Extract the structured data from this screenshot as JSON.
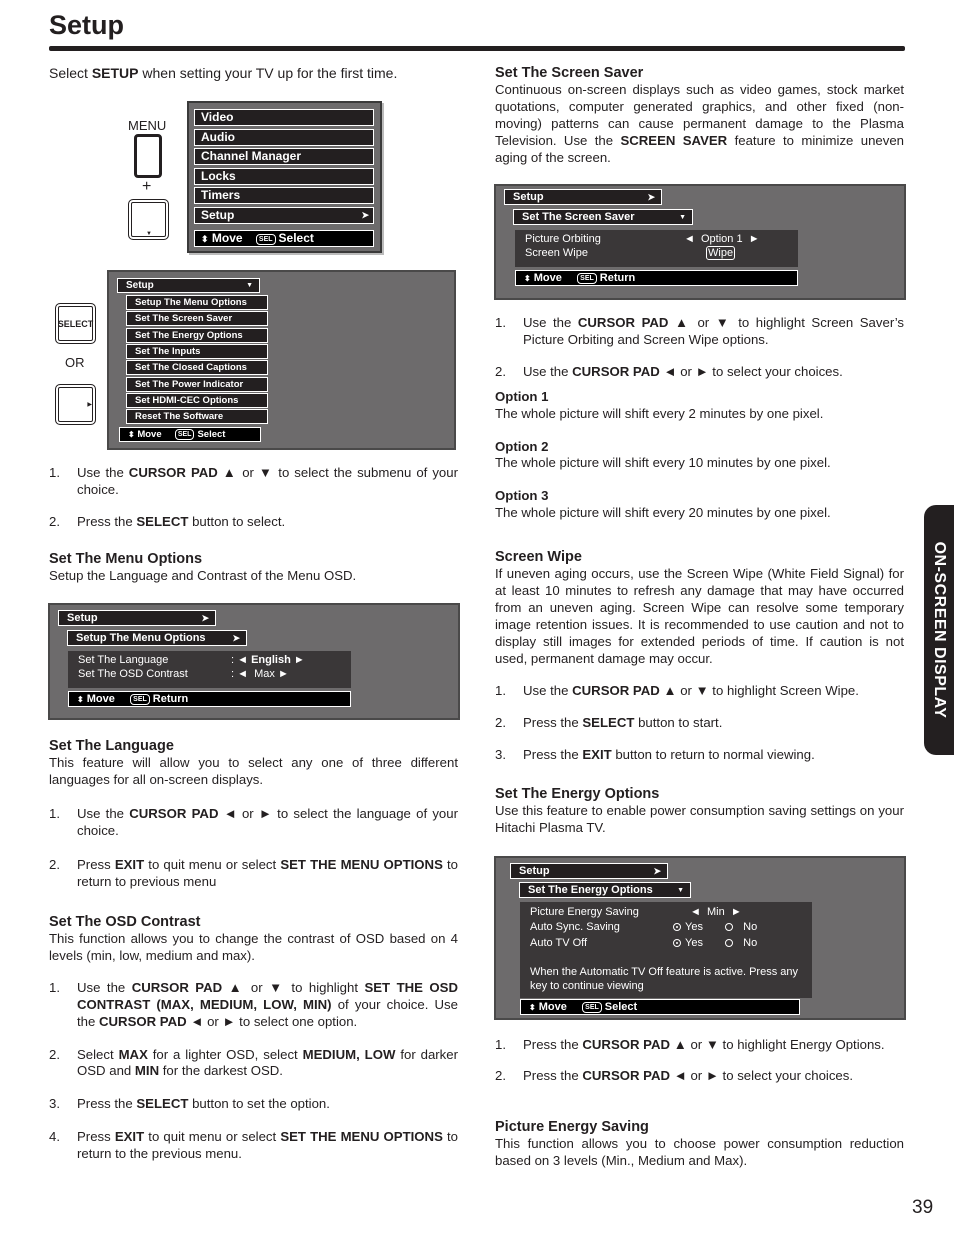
{
  "page": {
    "title": "Setup",
    "page_number": "39",
    "side_tab": "ON-SCREEN DISPLAY"
  },
  "intro": {
    "pre": "Select ",
    "bold": "SETUP",
    "post": " when setting your TV up for the first time."
  },
  "remote": {
    "menu_label": "MENU",
    "plus": "+",
    "select_label": "SELECT",
    "or": "OR"
  },
  "main_menu": {
    "items": [
      "Video",
      "Audio",
      "Channel Manager",
      "Locks",
      "Timers",
      "Setup"
    ],
    "footer_move": "Move",
    "footer_sel": "SEL",
    "footer_action": "Select"
  },
  "setup_menu": {
    "header": "Setup",
    "items": [
      "Setup The Menu Options",
      "Set The Screen Saver",
      "Set The Energy Options",
      "Set The Inputs",
      "Set The Closed Captions",
      "Set The Power Indicator",
      "Set HDMI-CEC Options",
      "Reset The Software"
    ],
    "footer_move": "Move",
    "footer_sel": "SEL",
    "footer_action": "Select"
  },
  "left_steps_1": [
    {
      "num": "1.",
      "parts": [
        [
          "Use the ",
          false
        ],
        [
          "CURSOR PAD",
          true
        ],
        [
          " ▲ or ▼ to select the submenu of your choice.",
          false
        ]
      ]
    },
    {
      "num": "2.",
      "parts": [
        [
          "Press the ",
          false
        ],
        [
          "SELECT",
          true
        ],
        [
          " button to select.",
          false
        ]
      ]
    }
  ],
  "menu_options": {
    "heading": "Set The Menu Options",
    "text": "Setup the Language and Contrast of the Menu OSD.",
    "osd": {
      "header": "Setup",
      "sub": "Setup The Menu Options",
      "rows": [
        {
          "label": "Set The Language",
          "value": "English"
        },
        {
          "label": "Set The OSD Contrast",
          "value": "Max"
        }
      ],
      "footer_move": "Move",
      "footer_sel": "SEL",
      "footer_action": "Return"
    }
  },
  "language": {
    "heading": "Set The Language",
    "text": "This feature will allow you to select any one of three different languages for all on-screen displays.",
    "steps": [
      {
        "num": "1.",
        "parts": [
          [
            "Use the ",
            false
          ],
          [
            "CURSOR PAD",
            true
          ],
          [
            " ◄ or ► to select the language of your choice.",
            false
          ]
        ]
      },
      {
        "num": "2.",
        "parts": [
          [
            "Press ",
            false
          ],
          [
            "EXIT",
            true
          ],
          [
            " to quit menu or select ",
            false
          ],
          [
            "SET THE MENU OPTIONS",
            true
          ],
          [
            " to return to previous menu",
            false
          ]
        ]
      }
    ]
  },
  "osd_contrast": {
    "heading": "Set The OSD Contrast",
    "text": "This function allows you to change the contrast of OSD based on 4 levels (min, low, medium and max).",
    "steps": [
      {
        "num": "1.",
        "parts": [
          [
            "Use the ",
            false
          ],
          [
            "CURSOR PAD",
            true
          ],
          [
            " ▲ or ▼ to highlight ",
            false
          ],
          [
            "SET THE OSD CONTRAST (MAX, MEDIUM, LOW, MIN)",
            true
          ],
          [
            " of your choice. Use the ",
            false
          ],
          [
            "CURSOR PAD",
            true
          ],
          [
            " ◄ or ► to select one option.",
            false
          ]
        ]
      },
      {
        "num": "2.",
        "parts": [
          [
            "Select ",
            false
          ],
          [
            "MAX",
            true
          ],
          [
            " for a lighter OSD, select ",
            false
          ],
          [
            "MEDIUM, LOW",
            true
          ],
          [
            " for darker OSD and ",
            false
          ],
          [
            "MIN",
            true
          ],
          [
            " for the darkest OSD.",
            false
          ]
        ]
      },
      {
        "num": "3.",
        "parts": [
          [
            "Press the ",
            false
          ],
          [
            "SELECT",
            true
          ],
          [
            " button to set the option.",
            false
          ]
        ]
      },
      {
        "num": "4.",
        "parts": [
          [
            "Press ",
            false
          ],
          [
            "EXIT",
            true
          ],
          [
            " to quit menu or select ",
            false
          ],
          [
            "SET THE MENU OPTIONS",
            true
          ],
          [
            " to return to the previous menu.",
            false
          ]
        ]
      }
    ]
  },
  "screen_saver": {
    "heading": "Set The Screen Saver",
    "text_parts": [
      [
        "Continuous on-screen displays such as video games, stock market quotations, computer generated graphics, and other fixed (non-moving) patterns can cause permanent damage to the Plasma Television. Use the ",
        false
      ],
      [
        "SCREEN SAVER",
        true
      ],
      [
        " feature to minimize uneven aging of the screen.",
        false
      ]
    ],
    "osd": {
      "header": "Setup",
      "sub": "Set The Screen Saver",
      "rows": [
        {
          "label": "Picture Orbiting",
          "value": "Option 1"
        },
        {
          "label": "Screen Wipe",
          "value": "Wipe"
        }
      ],
      "footer_move": "Move",
      "footer_sel": "SEL",
      "footer_action": "Return"
    },
    "steps": [
      {
        "num": "1.",
        "parts": [
          [
            "Use the ",
            false
          ],
          [
            "CURSOR PAD",
            true
          ],
          [
            " ▲ or ▼ to highlight Screen Saver’s Picture Orbiting and Screen Wipe options.",
            false
          ]
        ]
      },
      {
        "num": "2.",
        "parts": [
          [
            "Use the ",
            false
          ],
          [
            "CURSOR PAD",
            true
          ],
          [
            " ◄ or ► to select your choices.",
            false
          ]
        ]
      }
    ],
    "options": [
      {
        "title": "Option 1",
        "text": "The whole picture will shift every 2 minutes by one pixel."
      },
      {
        "title": "Option 2",
        "text": "The whole picture will shift every 10 minutes by one pixel."
      },
      {
        "title": "Option 3",
        "text": "The whole picture will shift every 20 minutes by one pixel."
      }
    ]
  },
  "screen_wipe": {
    "heading": "Screen Wipe",
    "text": "If uneven aging occurs, use the Screen Wipe (White Field Signal) for at least 10 minutes to refresh any damage that may have occurred from an uneven aging. Screen Wipe can resolve some temporary image retention issues. It is recommended to use caution and not to display still images for extended periods of time. If caution is not used, permanent damage may occur.",
    "steps": [
      {
        "num": "1.",
        "parts": [
          [
            "Use the ",
            false
          ],
          [
            "CURSOR PAD",
            true
          ],
          [
            " ▲ or ▼ to highlight Screen Wipe.",
            false
          ]
        ]
      },
      {
        "num": "2.",
        "parts": [
          [
            "Press the ",
            false
          ],
          [
            "SELECT",
            true
          ],
          [
            " button to start.",
            false
          ]
        ]
      },
      {
        "num": "3.",
        "parts": [
          [
            "Press the ",
            false
          ],
          [
            "EXIT",
            true
          ],
          [
            " button to return to normal viewing.",
            false
          ]
        ]
      }
    ]
  },
  "energy": {
    "heading": "Set The Energy Options",
    "text": "Use this feature to enable power consumption saving settings on your Hitachi Plasma TV.",
    "osd": {
      "header": "Setup",
      "sub": "Set The Energy Options",
      "picture_energy_label": "Picture Energy Saving",
      "picture_energy_value": "Min",
      "auto_sync_label": "Auto Sync. Saving",
      "auto_sync_selected": "Yes",
      "auto_off_label": "Auto TV Off",
      "auto_off_selected": "Yes",
      "yes": "Yes",
      "no": "No",
      "note": "When the Automatic TV Off feature is active. Press any key to continue viewing",
      "footer_move": "Move",
      "footer_sel": "SEL",
      "footer_action": "Select"
    },
    "steps": [
      {
        "num": "1.",
        "parts": [
          [
            "Press the ",
            false
          ],
          [
            "CURSOR PAD",
            true
          ],
          [
            " ▲ or ▼ to highlight Energy Options.",
            false
          ]
        ]
      },
      {
        "num": "2.",
        "parts": [
          [
            "Press the ",
            false
          ],
          [
            "CURSOR PAD",
            true
          ],
          [
            " ◄ or ► to select your choices.",
            false
          ]
        ]
      }
    ]
  },
  "picture_energy": {
    "heading": "Picture Energy Saving",
    "text": "This function allows you to choose power consumption reduction based on 3 levels (Min., Medium and Max)."
  }
}
